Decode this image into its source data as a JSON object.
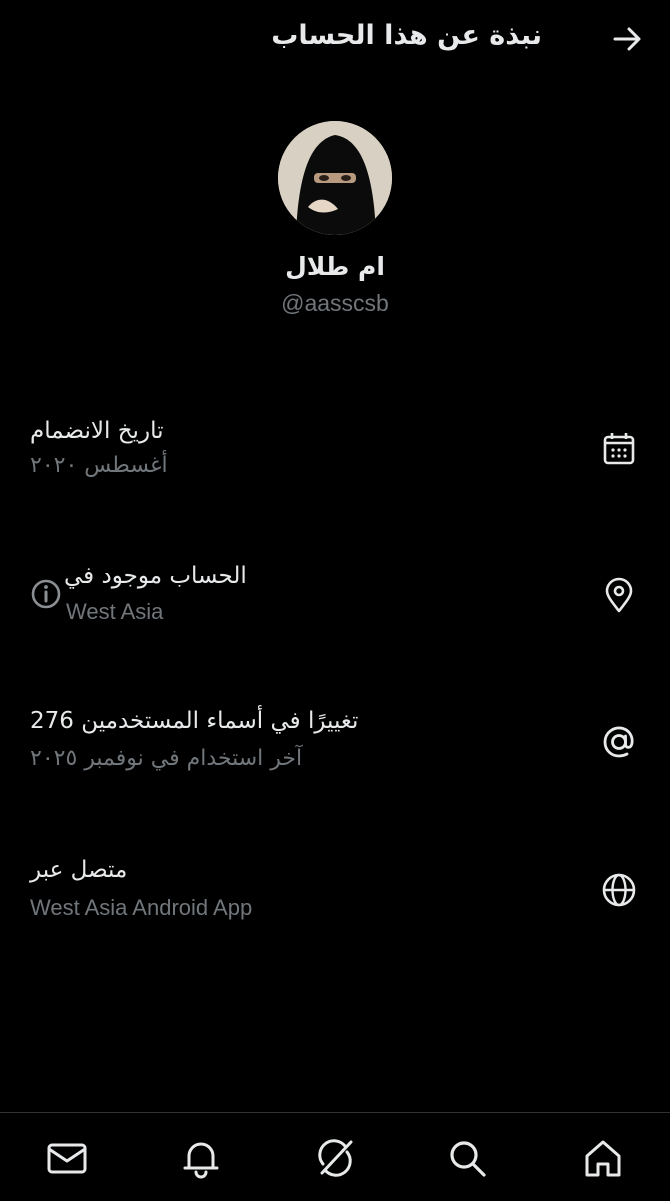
{
  "header": {
    "title": "نبذة عن هذا الحساب",
    "back_icon": "arrow-right-icon"
  },
  "profile": {
    "name": "ام طلال",
    "handle": "@aasscsb"
  },
  "rows": [
    {
      "label": "تاريخ الانضمام",
      "value": "أغسطس ٢٠٢٠",
      "icon": "calendar-icon"
    },
    {
      "label": "الحساب موجود في",
      "value": "West Asia",
      "icon": "location-pin-icon",
      "info_icon": "info-icon"
    },
    {
      "label": "تغييرًا في أسماء المستخدمين 276",
      "value": "آخر استخدام في نوفمبر ٢٠٢٥",
      "icon": "at-sign-icon"
    },
    {
      "label": "متصل عبر",
      "value": "West Asia Android App",
      "icon": "globe-icon"
    }
  ],
  "bottom_nav": [
    "messages-icon",
    "notifications-icon",
    "grok-icon",
    "search-icon",
    "home-icon"
  ],
  "colors": {
    "background": "#000000",
    "primary_text": "#e7e9ea",
    "secondary_text": "#71767b",
    "divider": "#2f3336"
  }
}
